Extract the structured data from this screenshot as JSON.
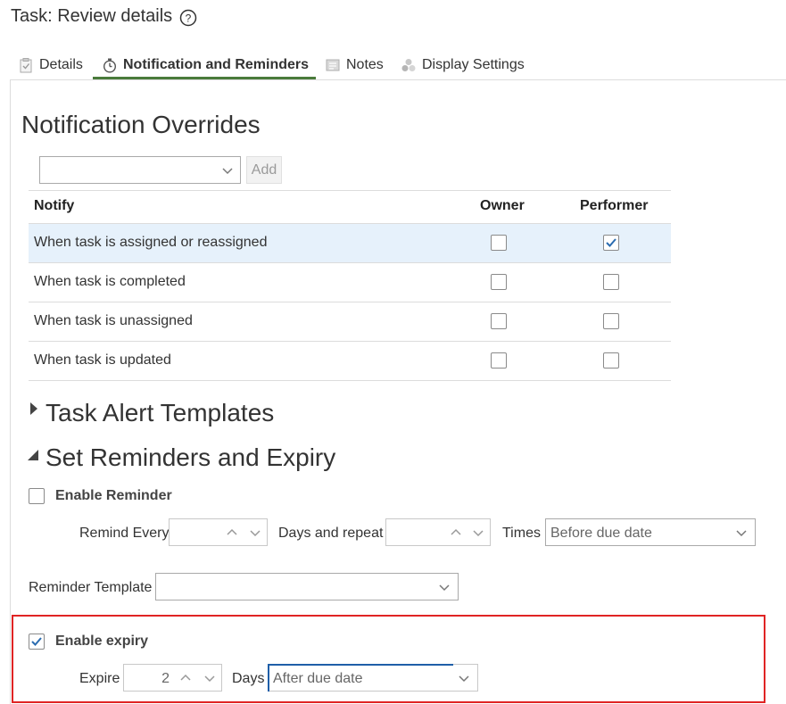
{
  "page": {
    "title": "Task: Review details"
  },
  "tabs": [
    {
      "label": "Details",
      "icon": "clipboard-check-icon"
    },
    {
      "label": "Notification and Reminders",
      "icon": "stopwatch-icon"
    },
    {
      "label": "Notes",
      "icon": "note-icon"
    },
    {
      "label": "Display Settings",
      "icon": "circles-icon"
    }
  ],
  "active_tab": "Notification and Reminders",
  "notification_overrides": {
    "heading": "Notification Overrides",
    "dropdown_value": "",
    "add_label": "Add",
    "columns": [
      "Notify",
      "Owner",
      "Performer"
    ],
    "rows": [
      {
        "label": "When task is assigned or reassigned",
        "owner": false,
        "performer": true,
        "selected": true
      },
      {
        "label": "When task is completed",
        "owner": false,
        "performer": false,
        "selected": false
      },
      {
        "label": "When task is unassigned",
        "owner": false,
        "performer": false,
        "selected": false
      },
      {
        "label": "When task is updated",
        "owner": false,
        "performer": false,
        "selected": false
      }
    ]
  },
  "task_alert_templates": {
    "heading": "Task Alert Templates",
    "expanded": false
  },
  "reminders": {
    "heading": "Set Reminders and Expiry",
    "expanded": true,
    "enable_reminder_label": "Enable Reminder",
    "enable_reminder_checked": false,
    "remind_every_label": "Remind Every",
    "remind_every_value": "",
    "days_and_repeat_label": "Days and repeat",
    "repeat_value": "",
    "times_label": "Times",
    "reminder_timing_value": "Before due date",
    "reminder_template_label": "Reminder Template",
    "reminder_template_value": ""
  },
  "expiry": {
    "enable_expiry_label": "Enable expiry",
    "enable_expiry_checked": true,
    "expire_label": "Expire",
    "expire_value": "2",
    "days_label": "Days",
    "expiry_timing_value": "After due date"
  },
  "colors": {
    "tab_underline": "#4a7b3b",
    "selected_row": "#e6f1fb",
    "checkbox_check": "#2b6cb0",
    "highlight_border": "#e02424",
    "focus_border": "#1f5fa8"
  }
}
